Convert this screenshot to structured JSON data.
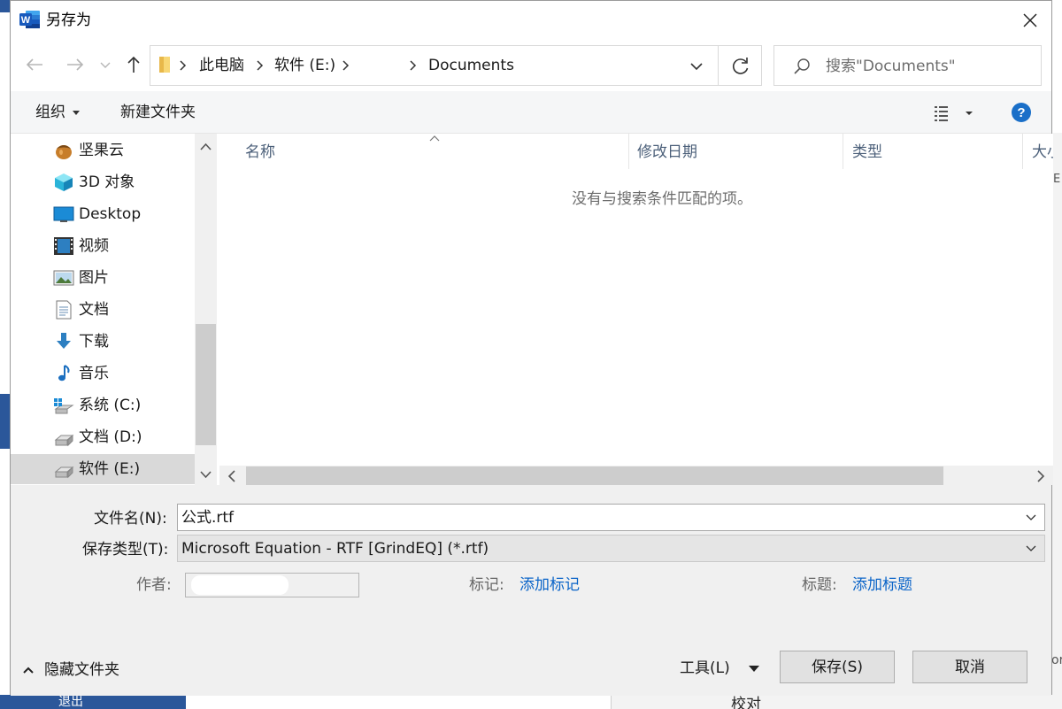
{
  "background": {
    "bottom_left_text": "退出",
    "bottom_right_text": "校对",
    "right_glyph_top": "E",
    "right_glyph_bottom": "or",
    "word_blue": "#2b579a"
  },
  "dialog": {
    "title": "另存为",
    "app_icon": "word-icon",
    "close_icon": "close-icon"
  },
  "address": {
    "crumbs": [
      "此电脑",
      "软件 (E:)",
      "",
      "Documents"
    ],
    "refresh_icon": "refresh-icon"
  },
  "search": {
    "placeholder": "搜索\"Documents\""
  },
  "toolbar": {
    "organize_label": "组织",
    "new_folder_label": "新建文件夹",
    "help_label": "?"
  },
  "nav_tree": {
    "items": [
      {
        "label": "坚果云",
        "icon": "nut-cloud-icon"
      },
      {
        "label": "3D 对象",
        "icon": "cube-3d-icon"
      },
      {
        "label": "Desktop",
        "icon": "desktop-icon"
      },
      {
        "label": "视频",
        "icon": "video-icon"
      },
      {
        "label": "图片",
        "icon": "pictures-icon"
      },
      {
        "label": "文档",
        "icon": "document-icon"
      },
      {
        "label": "下载",
        "icon": "download-icon"
      },
      {
        "label": "音乐",
        "icon": "music-icon"
      },
      {
        "label": "系统 (C:)",
        "icon": "system-drive-icon"
      },
      {
        "label": "文档 (D:)",
        "icon": "drive-icon"
      },
      {
        "label": "软件 (E:)",
        "icon": "drive-icon",
        "selected": true
      }
    ]
  },
  "file_list": {
    "columns": [
      "名称",
      "修改日期",
      "类型",
      "大小"
    ],
    "empty_message": "没有与搜索条件匹配的项。"
  },
  "form": {
    "filename_label": "文件名(N):",
    "filename_value": "公式.rtf",
    "filetype_label": "保存类型(T):",
    "filetype_value": "Microsoft Equation - RTF [GrindEQ] (*.rtf)",
    "author_label": "作者:",
    "tags_label": "标记:",
    "tags_link": "添加标记",
    "title_label": "标题:",
    "title_link": "添加标题",
    "hide_folders_label": "隐藏文件夹",
    "tools_label": "工具(L)",
    "save_label": "保存(S)",
    "cancel_label": "取消",
    "link_color": "#0a64c8"
  }
}
